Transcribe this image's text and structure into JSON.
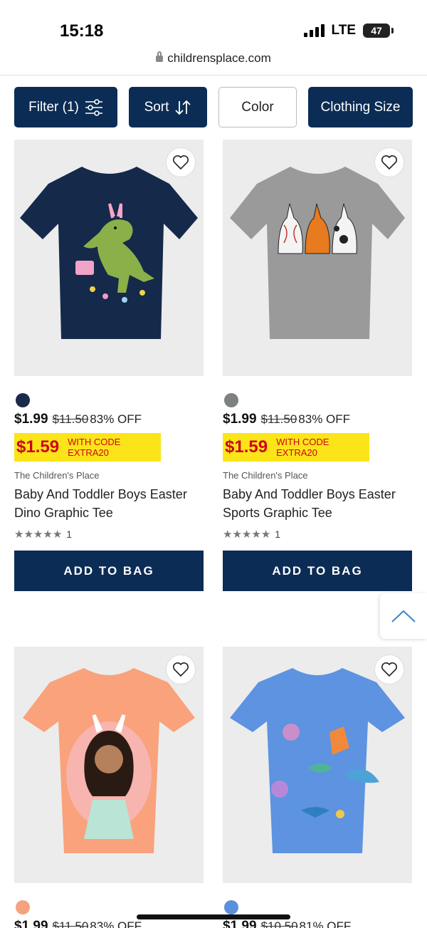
{
  "status": {
    "time": "15:18",
    "network": "LTE",
    "battery": "47"
  },
  "browser": {
    "url": "childrensplace.com"
  },
  "filters": {
    "filter_label": "Filter (1)",
    "sort_label": "Sort",
    "color_label": "Color",
    "size_label": "Clothing Size"
  },
  "products": [
    {
      "price": "$1.99",
      "original_price": "$11.50",
      "discount": "83% OFF",
      "promo_price": "$1.59",
      "promo_code": "WITH CODE EXTRA20",
      "brand": "The Children's Place",
      "name": "Baby And Toddler Boys Easter Dino Graphic Tee",
      "rating_count": "1",
      "swatch_color": "#1b2a4a",
      "shirt_color": "#15294b",
      "button_label": "ADD TO BAG"
    },
    {
      "price": "$1.99",
      "original_price": "$11.50",
      "discount": "83% OFF",
      "promo_price": "$1.59",
      "promo_code": "WITH CODE EXTRA20",
      "brand": "The Children's Place",
      "name": "Baby And Toddler Boys Easter Sports Graphic Tee",
      "rating_count": "1",
      "swatch_color": "#7e827e",
      "shirt_color": "#9a9a9a",
      "button_label": "ADD TO BAG"
    },
    {
      "price": "$1.99",
      "original_price": "$11.50",
      "discount": "83% OFF",
      "swatch_color": "#f4a27f",
      "shirt_color": "#f9a27b"
    },
    {
      "price": "$1.99",
      "original_price": "$10.50",
      "discount": "81% OFF",
      "swatch_color": "#5a8fdc",
      "shirt_color": "#5d93e0"
    }
  ]
}
